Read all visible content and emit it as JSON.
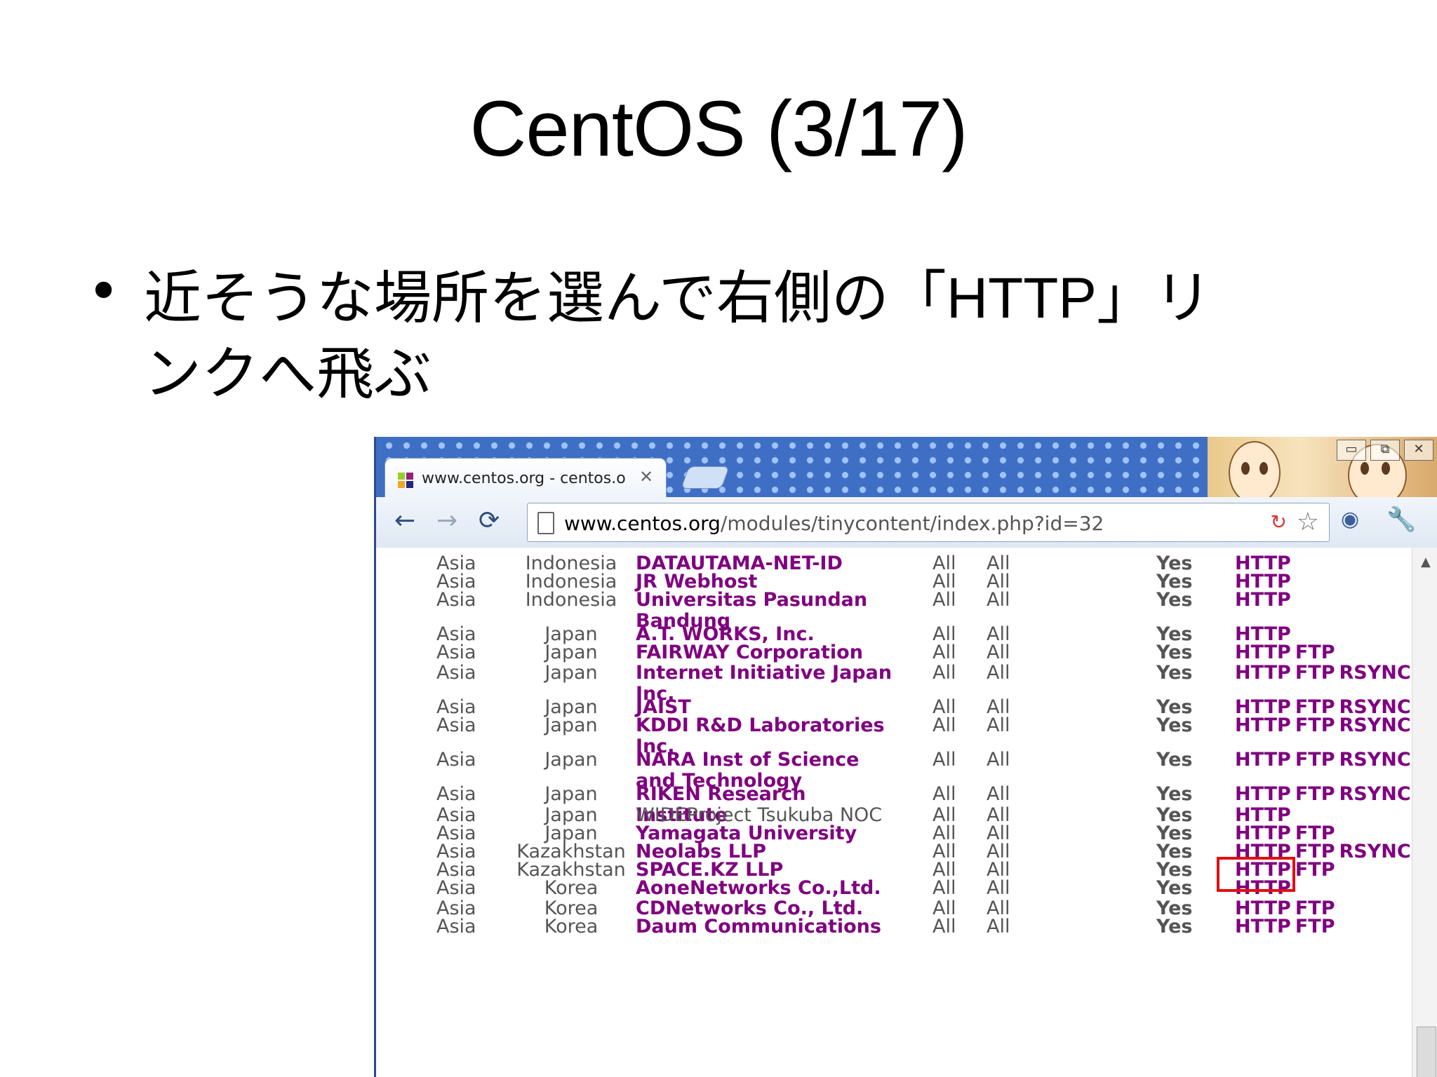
{
  "slide": {
    "title": "CentOS (3/17)",
    "bullet_symbol": "•",
    "bullet_part1": "近そうな場所を選んで右側の「",
    "bullet_highlight": "HTTP",
    "bullet_part2": "」リ",
    "bullet_line2": "ンクへ飛ぶ"
  },
  "browser": {
    "tab_title": "www.centos.org - centos.o",
    "tab_close": "×",
    "url_host": "www.centos.org",
    "url_path": "/modules/tinycontent/index.php?id=32",
    "icons": {
      "back": "←",
      "forward": "→",
      "reload": "⟳",
      "star": "☆",
      "wrench": "🔧",
      "eye": "◉",
      "omnibox": "↻",
      "minimize": "▭",
      "maximize": "⧉",
      "close": "✕",
      "scroll_up": "▲"
    }
  },
  "mirrors": [
    {
      "region": "Asia",
      "country": "Indonesia",
      "name": "DATAUTAMA-NET-ID",
      "c1": "All",
      "c2": "All",
      "yes": "Yes",
      "links": [
        "HTTP"
      ]
    },
    {
      "region": "Asia",
      "country": "Indonesia",
      "name": "JR Webhost",
      "c1": "All",
      "c2": "All",
      "yes": "Yes",
      "links": [
        "HTTP"
      ]
    },
    {
      "region": "Asia",
      "country": "Indonesia",
      "name": "Universitas Pasundan Bandung",
      "c1": "All",
      "c2": "All",
      "yes": "Yes",
      "links": [
        "HTTP"
      ]
    },
    {
      "region": "Asia",
      "country": "Japan",
      "name": "A.T. WORKS, Inc.",
      "c1": "All",
      "c2": "All",
      "yes": "Yes",
      "links": [
        "HTTP"
      ]
    },
    {
      "region": "Asia",
      "country": "Japan",
      "name": "FAIRWAY Corporation",
      "c1": "All",
      "c2": "All",
      "yes": "Yes",
      "links": [
        "HTTP",
        "FTP"
      ]
    },
    {
      "region": "Asia",
      "country": "Japan",
      "name": "Internet Initiative Japan Inc.",
      "c1": "All",
      "c2": "All",
      "yes": "Yes",
      "links": [
        "HTTP",
        "FTP",
        "RSYNC"
      ]
    },
    {
      "region": "Asia",
      "country": "Japan",
      "name": "JAIST",
      "c1": "All",
      "c2": "All",
      "yes": "Yes",
      "links": [
        "HTTP",
        "FTP",
        "RSYNC"
      ]
    },
    {
      "region": "Asia",
      "country": "Japan",
      "name": "KDDI R&D Laboratories Inc.",
      "c1": "All",
      "c2": "All",
      "yes": "Yes",
      "links": [
        "HTTP",
        "FTP",
        "RSYNC"
      ]
    },
    {
      "region": "Asia",
      "country": "Japan",
      "name": "NARA Inst of Science and Technology",
      "c1": "All",
      "c2": "All",
      "yes": "Yes",
      "links": [
        "HTTP",
        "FTP",
        "RSYNC"
      ]
    },
    {
      "region": "Asia",
      "country": "Japan",
      "name": "RIKEN Research Institute",
      "c1": "All",
      "c2": "All",
      "yes": "Yes",
      "links": [
        "HTTP",
        "FTP",
        "RSYNC"
      ]
    },
    {
      "region": "Asia",
      "country": "Japan",
      "name": "WIDEProject Tsukuba NOC",
      "c1": "All",
      "c2": "All",
      "yes": "Yes",
      "links": [
        "HTTP"
      ]
    },
    {
      "region": "Asia",
      "country": "Japan",
      "name": "Yamagata University",
      "c1": "All",
      "c2": "All",
      "yes": "Yes",
      "links": [
        "HTTP",
        "FTP"
      ]
    },
    {
      "region": "Asia",
      "country": "Kazakhstan",
      "name": "Neolabs LLP",
      "c1": "All",
      "c2": "All",
      "yes": "Yes",
      "links": [
        "HTTP",
        "FTP",
        "RSYNC"
      ]
    },
    {
      "region": "Asia",
      "country": "Kazakhstan",
      "name": "SPACE.KZ LLP",
      "c1": "All",
      "c2": "All",
      "yes": "Yes",
      "links": [
        "HTTP",
        "FTP"
      ]
    },
    {
      "region": "Asia",
      "country": "Korea",
      "name": "AoneNetworks Co.,Ltd.",
      "c1": "All",
      "c2": "All",
      "yes": "Yes",
      "links": [
        "HTTP"
      ]
    },
    {
      "region": "Asia",
      "country": "Korea",
      "name": "CDNetworks Co., Ltd.",
      "c1": "All",
      "c2": "All",
      "yes": "Yes",
      "links": [
        "HTTP",
        "FTP"
      ]
    },
    {
      "region": "Asia",
      "country": "Korea",
      "name": "Daum Communications",
      "c1": "All",
      "c2": "All",
      "yes": "Yes",
      "links": [
        "HTTP",
        "FTP"
      ]
    }
  ]
}
